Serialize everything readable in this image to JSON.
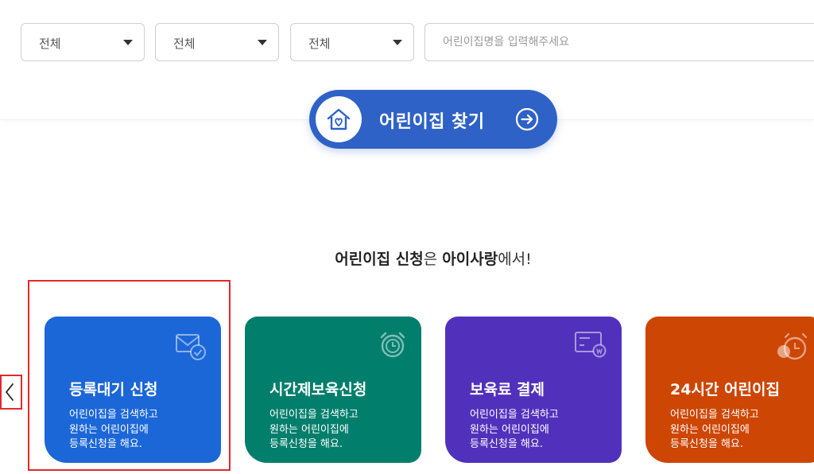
{
  "search": {
    "region_select": "전체",
    "district_select": "전체",
    "type_select": "전체",
    "keyword_placeholder": "어린이집명을 입력해주세요",
    "find_button_label": "어린이집 찾기"
  },
  "tagline": {
    "part1": "어린이집 신청",
    "part2": "은 ",
    "part3": "아이사랑",
    "part4": "에서!"
  },
  "cards": [
    {
      "title": "등록대기 신청",
      "desc": [
        "어린이집을 검색하고",
        "원하는 어린이집에",
        "등록신청을 해요."
      ],
      "icon": "envelope-check-icon",
      "color": "#1c67d8"
    },
    {
      "title": "시간제보육신청",
      "desc": [
        "어린이집을 검색하고",
        "원하는 어린이집에",
        "등록신청을 해요."
      ],
      "icon": "alarm-clock-icon",
      "color": "#017e6c"
    },
    {
      "title": "보육료 결제",
      "desc": [
        "어린이집을 검색하고",
        "원하는 어린이집에",
        "등록신청을 해요."
      ],
      "icon": "payment-card-icon",
      "color": "#5131bc"
    },
    {
      "title": "24시간 어린이집",
      "desc": [
        "어린이집을 검색하고",
        "원하는 어린이집에",
        "등록신청을 해요."
      ],
      "icon": "clock-24-icon",
      "color": "#cd4604"
    }
  ],
  "colors": {
    "primary_button": "#2f62c7",
    "highlight": "#e02a2a"
  }
}
